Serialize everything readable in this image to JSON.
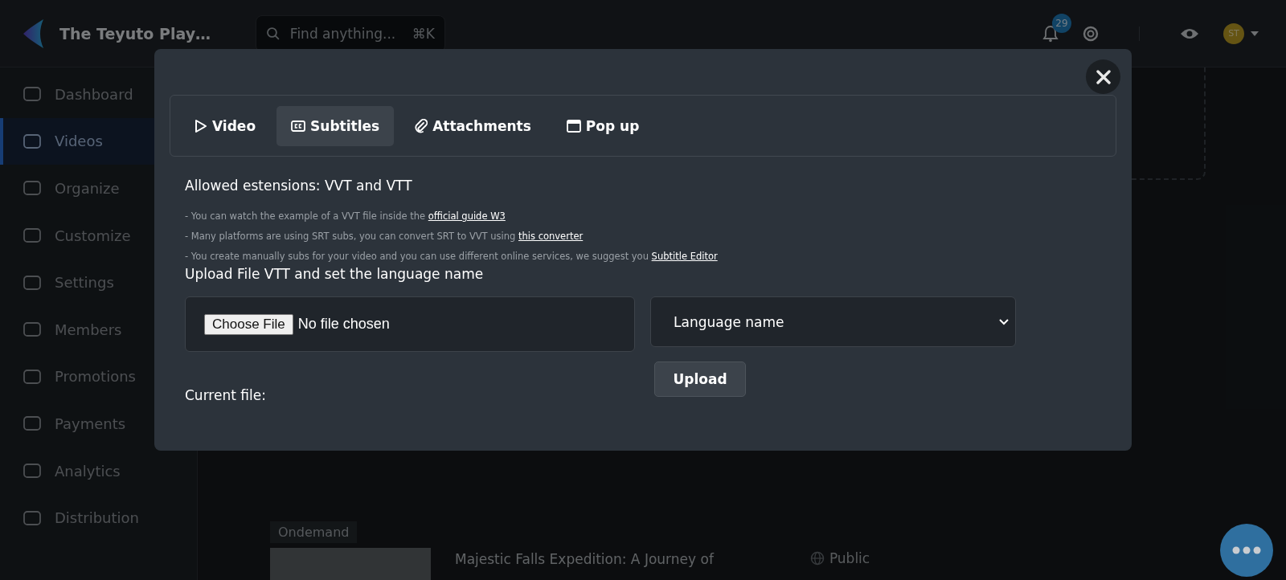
{
  "app": {
    "title": "The Teyuto Play…",
    "search": {
      "placeholder": "Find anything...",
      "shortcut": "⌘K"
    },
    "notifications": {
      "count": "29"
    },
    "avatar": {
      "initials": "ST"
    }
  },
  "sidebar": {
    "items": [
      {
        "label": "Dashboard",
        "selected": false
      },
      {
        "label": "Videos",
        "selected": true
      },
      {
        "label": "Organize",
        "selected": false
      },
      {
        "label": "Customize",
        "selected": false
      },
      {
        "label": "Settings",
        "selected": false
      },
      {
        "label": "Members",
        "selected": false
      },
      {
        "label": "Promotions",
        "selected": false
      },
      {
        "label": "Payments",
        "selected": false
      },
      {
        "label": "Analytics",
        "selected": false
      },
      {
        "label": "Distribution",
        "selected": false
      }
    ]
  },
  "content": {
    "card": {
      "tag": "Ondemand",
      "title": "Majestic Falls Expedition: A Journey of",
      "visibility": "Public"
    }
  },
  "modal": {
    "tabs": [
      {
        "label": "Video",
        "selected": false
      },
      {
        "label": "Subtitles",
        "selected": true
      },
      {
        "label": "Attachments",
        "selected": false
      },
      {
        "label": "Pop up",
        "selected": false
      }
    ],
    "heading": "Allowed estensions: VVT and VTT",
    "notes": [
      {
        "text": "- You can watch the example of a VVT file inside the",
        "link": "official guide W3"
      },
      {
        "text": "- Many platforms are using SRT subs, you can convert SRT to VVT using",
        "link": "this converter"
      },
      {
        "text": "- You create manually subs for your video and you can use different online services, we suggest you",
        "link": "Subtitle Editor"
      }
    ],
    "upload_heading": "Upload File VTT and set the language name",
    "file_button": "Choose File",
    "file_status": "No file chosen",
    "language_placeholder": "Language name",
    "upload_button": "Upload",
    "current_file_label": "Current file:"
  }
}
